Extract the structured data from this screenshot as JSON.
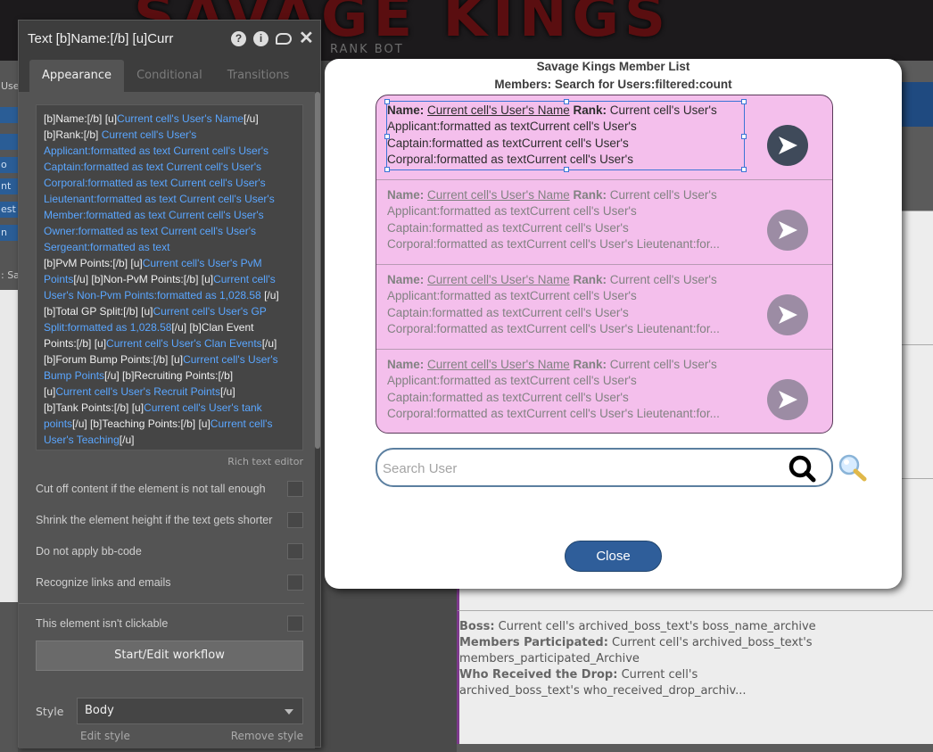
{
  "background": {
    "banner_text": "SAVAGE KINGS",
    "banner_sub": "RANK BOT",
    "left_labels": [
      "Use",
      "",
      "o",
      "nt",
      "est",
      "n",
      ": Sa"
    ],
    "archive": {
      "boss_label": "Boss:",
      "boss_value": "Current cell's archived_boss_text's boss_name_archive",
      "members_label": "Members Participated:",
      "members_value": "Current cell's archived_boss_text's members_participated_Archive",
      "drop_label": "Who Received the Drop:",
      "drop_value": "Current cell's archived_boss_text's who_received_drop_archiv..."
    }
  },
  "panel": {
    "title": "Text [b]Name:[/b] [u]Curr",
    "tabs": [
      {
        "label": "Appearance",
        "active": true
      },
      {
        "label": "Conditional",
        "active": false
      },
      {
        "label": "Transitions",
        "active": false
      }
    ],
    "code_lines": [
      {
        "t1": "[b]Name:[/b] [u]",
        "d1": "Current cell's User's Name",
        "t2": "[/u]"
      },
      {
        "t1": "[b]Rank:[/b] ",
        "d1": "Current cell's User's",
        "t2": ""
      },
      {
        "t1": "",
        "d1": "Applicant:formatted as text  Current cell's User's",
        "t2": ""
      },
      {
        "t1": "",
        "d1": "Captain:formatted as text  Current cell's User's",
        "t2": ""
      },
      {
        "t1": "",
        "d1": "Corporal:formatted as text  Current cell's User's",
        "t2": ""
      },
      {
        "t1": "",
        "d1": "Lieutenant:formatted as text  Current cell's User's",
        "t2": ""
      },
      {
        "t1": "",
        "d1": "Member:formatted as text  Current cell's User's",
        "t2": ""
      },
      {
        "t1": "",
        "d1": "Owner:formatted as text  Current cell's User's",
        "t2": ""
      },
      {
        "t1": "",
        "d1": "Sergeant:formatted as text",
        "t2": ""
      },
      {
        "t1": "[b]PvM Points:[/b] [u]",
        "d1": "Current cell's User's PvM",
        "t2": ""
      },
      {
        "t1": "",
        "d1": "Points",
        "t2": "[/u] [b]Non-PvM Points:[/b] [u]",
        "d2": "Current cell's"
      },
      {
        "t1": "",
        "d1": "User's Non-Pvm Points:formatted as 1,028.58",
        "t2": " [/u]"
      },
      {
        "t1": "[b]Total GP Split:[/b] [u]",
        "d1": "Current cell's User's GP",
        "t2": ""
      },
      {
        "t1": "",
        "d1": "Split:formatted as 1,028.58",
        "t2": "[/u]  [b]Clan Event"
      },
      {
        "t1": "Points:[/b] [u]",
        "d1": "Current cell's User's Clan Events",
        "t2": "[/u]"
      },
      {
        "t1": "[b]Forum Bump Points:[/b] [u]",
        "d1": "Current cell's User's",
        "t2": ""
      },
      {
        "t1": "",
        "d1": "Bump Points",
        "t2": "[/u]  [b]Recruiting Points:[/b]"
      },
      {
        "t1": "[u]",
        "d1": "Current cell's User's Recruit Points",
        "t2": "[/u]"
      },
      {
        "t1": "[b]Tank Points:[/b] [u]",
        "d1": "Current cell's User's tank",
        "t2": ""
      },
      {
        "t1": "",
        "d1": "points",
        "t2": "[/u]  [b]Teaching Points:[/b] [u]",
        "d2": "Current cell's"
      },
      {
        "t1": "",
        "d1": "User's Teaching",
        "t2": "[/u]"
      }
    ],
    "rich_text_label": "Rich text editor",
    "options": [
      {
        "label": "Cut off content if the element is not tall enough"
      },
      {
        "label": "Shrink the element height if the text gets shorter"
      },
      {
        "label": "Do not apply bb-code"
      },
      {
        "label": "Recognize links and emails"
      }
    ],
    "clickable_label": "This element isn't clickable",
    "workflow_button": "Start/Edit workflow",
    "style_label": "Style",
    "style_value": "Body",
    "edit_style": "Edit style",
    "remove_style": "Remove style"
  },
  "modal": {
    "title": "Savage Kings Member List",
    "subtitle": "Members: Search for Users:filtered:count",
    "members": [
      {
        "name_label": "Name:",
        "name_value": "Current cell's User's Name",
        "rank_label": "Rank:",
        "rank_value": "Current cell's User's",
        "line2": "Applicant:formatted as textCurrent cell's User's",
        "line3": "Captain:formatted as textCurrent cell's User's",
        "line4": "Corporal:formatted as textCurrent cell's User's"
      },
      {
        "name_label": "Name:",
        "name_value": "Current cell's User's Name",
        "rank_label": "Rank:",
        "rank_value": "Current cell's User's",
        "line2": "Applicant:formatted as textCurrent cell's User's",
        "line3": "Captain:formatted as textCurrent cell's User's",
        "line4": "Corporal:formatted as textCurrent cell's User's Lieutenant:for..."
      },
      {
        "name_label": "Name:",
        "name_value": "Current cell's User's Name",
        "rank_label": "Rank:",
        "rank_value": "Current cell's User's",
        "line2": "Applicant:formatted as textCurrent cell's User's",
        "line3": "Captain:formatted as textCurrent cell's User's",
        "line4": "Corporal:formatted as textCurrent cell's User's Lieutenant:for..."
      },
      {
        "name_label": "Name:",
        "name_value": "Current cell's User's Name",
        "rank_label": "Rank:",
        "rank_value": "Current cell's User's",
        "line2": "Applicant:formatted as textCurrent cell's User's",
        "line3": "Captain:formatted as textCurrent cell's User's",
        "line4": "Corporal:formatted as textCurrent cell's User's Lieutenant:for..."
      }
    ],
    "search_placeholder": "Search User",
    "search_value": "",
    "close_label": "Close",
    "colors": {
      "list_bg": "#f4bfec",
      "close_button": "#2f5e9a",
      "go_button": "#3f4a5a"
    }
  }
}
